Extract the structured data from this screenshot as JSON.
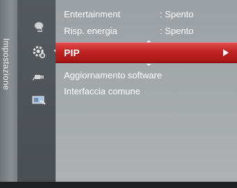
{
  "sidebar": {
    "title": "Impostazione"
  },
  "icons": [
    {
      "name": "satellite-dish-icon"
    },
    {
      "name": "gear-settings-icon"
    },
    {
      "name": "input-plug-icon"
    },
    {
      "name": "support-tools-icon"
    }
  ],
  "menu": {
    "items": [
      {
        "label": "Entertainment",
        "value": ": Spento"
      },
      {
        "label": "Risp. energia",
        "value": ": Spento"
      },
      {
        "label": "PIP",
        "value": ""
      },
      {
        "label": "Aggiornamento software",
        "value": ""
      },
      {
        "label": "Interfaccia comune",
        "value": ""
      }
    ],
    "selected_index": 2
  },
  "colors": {
    "selection": "#c02424",
    "background": "#a3a8ab",
    "icon_column": "#4f5458"
  }
}
